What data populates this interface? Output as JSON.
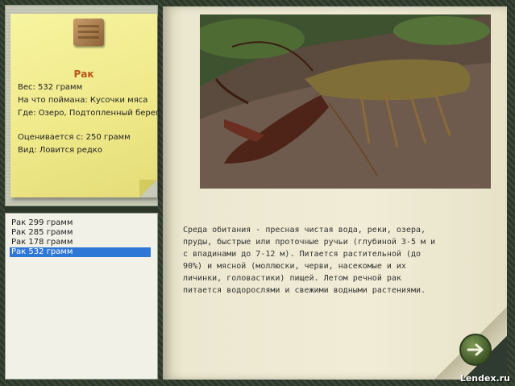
{
  "note": {
    "title": "Рак",
    "weight": "Вес: 532 грамм",
    "caught_with": "На что поймана: Кусочки мяса",
    "where": "Где: Озеро, Подтопленный берег",
    "value": "Оценивается с: 250 грамм",
    "kind": "Вид: Ловится редко"
  },
  "catch_list": [
    {
      "label": "Рак 299 грамм",
      "selected": false
    },
    {
      "label": "Рак 285 грамм",
      "selected": false
    },
    {
      "label": "Рак 178 грамм",
      "selected": false
    },
    {
      "label": "Рак 532 грамм",
      "selected": true
    }
  ],
  "description": "Среда обитания - пресная чистая вода, реки, озера, пруды, быстрые или проточные ручьи (глубиной 3-5 м и с впадинами до 7-12 м). Питается растительной (до 90%) и мясной (моллюски, черви, насекомые и их личинки, головастики) пищей. Летом речной рак питается водорослями и свежими водными растениями.",
  "next_icon": "arrow-right-icon",
  "watermark": "Lendex.ru",
  "colors": {
    "title": "#b8561a",
    "selection": "#2f77d6",
    "sticky": "#f2ee94"
  }
}
